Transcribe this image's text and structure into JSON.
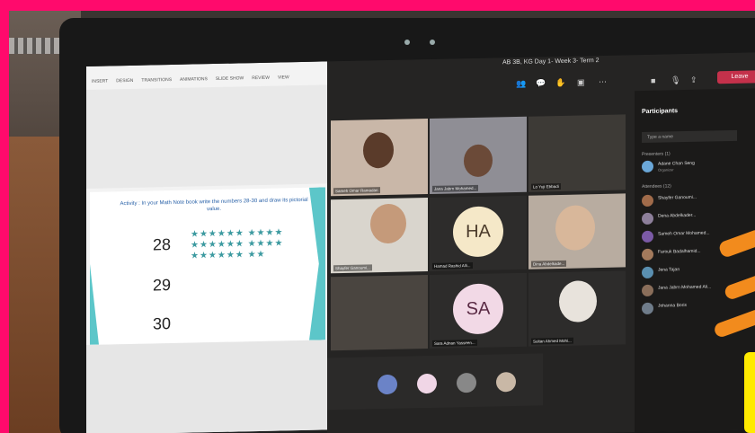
{
  "screen": {
    "ppt_menu": [
      "INSERT",
      "DESIGN",
      "TRANSITIONS",
      "ANIMATIONS",
      "SLIDE SHOW",
      "REVIEW",
      "VIEW"
    ],
    "slide": {
      "activity": "Activity : In your Math Note book write the numbers 28-30 and draw its pictorial value.",
      "numbers": [
        "28",
        "29",
        "30"
      ],
      "stars_28_row1": "★★★★★★ ★★★★",
      "stars_28_row2": "★★★★★★ ★★★★",
      "stars_28_row3": "★★★★★★ ★★"
    },
    "teams": {
      "meeting_title": "AB 3B, KG Day 1- Week 3- Term 2",
      "leave_label": "Leave",
      "tiles": [
        {
          "name": "Sameh Omar Ramadan"
        },
        {
          "name": "Jana Jabrn Mohamed..."
        },
        {
          "name": "Lo Yuji Ebbadi"
        },
        {
          "name": "Shayfer Ganoumi..."
        },
        {
          "name": "Hamad Rashid Alli..."
        },
        {
          "name": "Dina Abdelkade..."
        },
        {
          "name": "Sara Adnan Yasseen..."
        },
        {
          "name": "Sultan Ahmed Mohi..."
        }
      ],
      "initials_ha": "HA",
      "initials_sa": "SA"
    },
    "participants": {
      "title": "Participants",
      "invite_placeholder": "Type a name",
      "presenters_label": "Presenters (1)",
      "attendees_label": "Attendees (12)",
      "list": [
        {
          "name": "Adane Chan Seng",
          "role": "Organizer"
        },
        {
          "name": "Shayfer Ganoumi..."
        },
        {
          "name": "Dena Abdelkader..."
        },
        {
          "name": "Sameh Omar Mohamed..."
        },
        {
          "name": "Farouk Badalhamid..."
        },
        {
          "name": "Jena Tajan"
        },
        {
          "name": "Jana Jabrn Mohamed Ali..."
        },
        {
          "name": "Johanna Boris"
        }
      ]
    }
  }
}
